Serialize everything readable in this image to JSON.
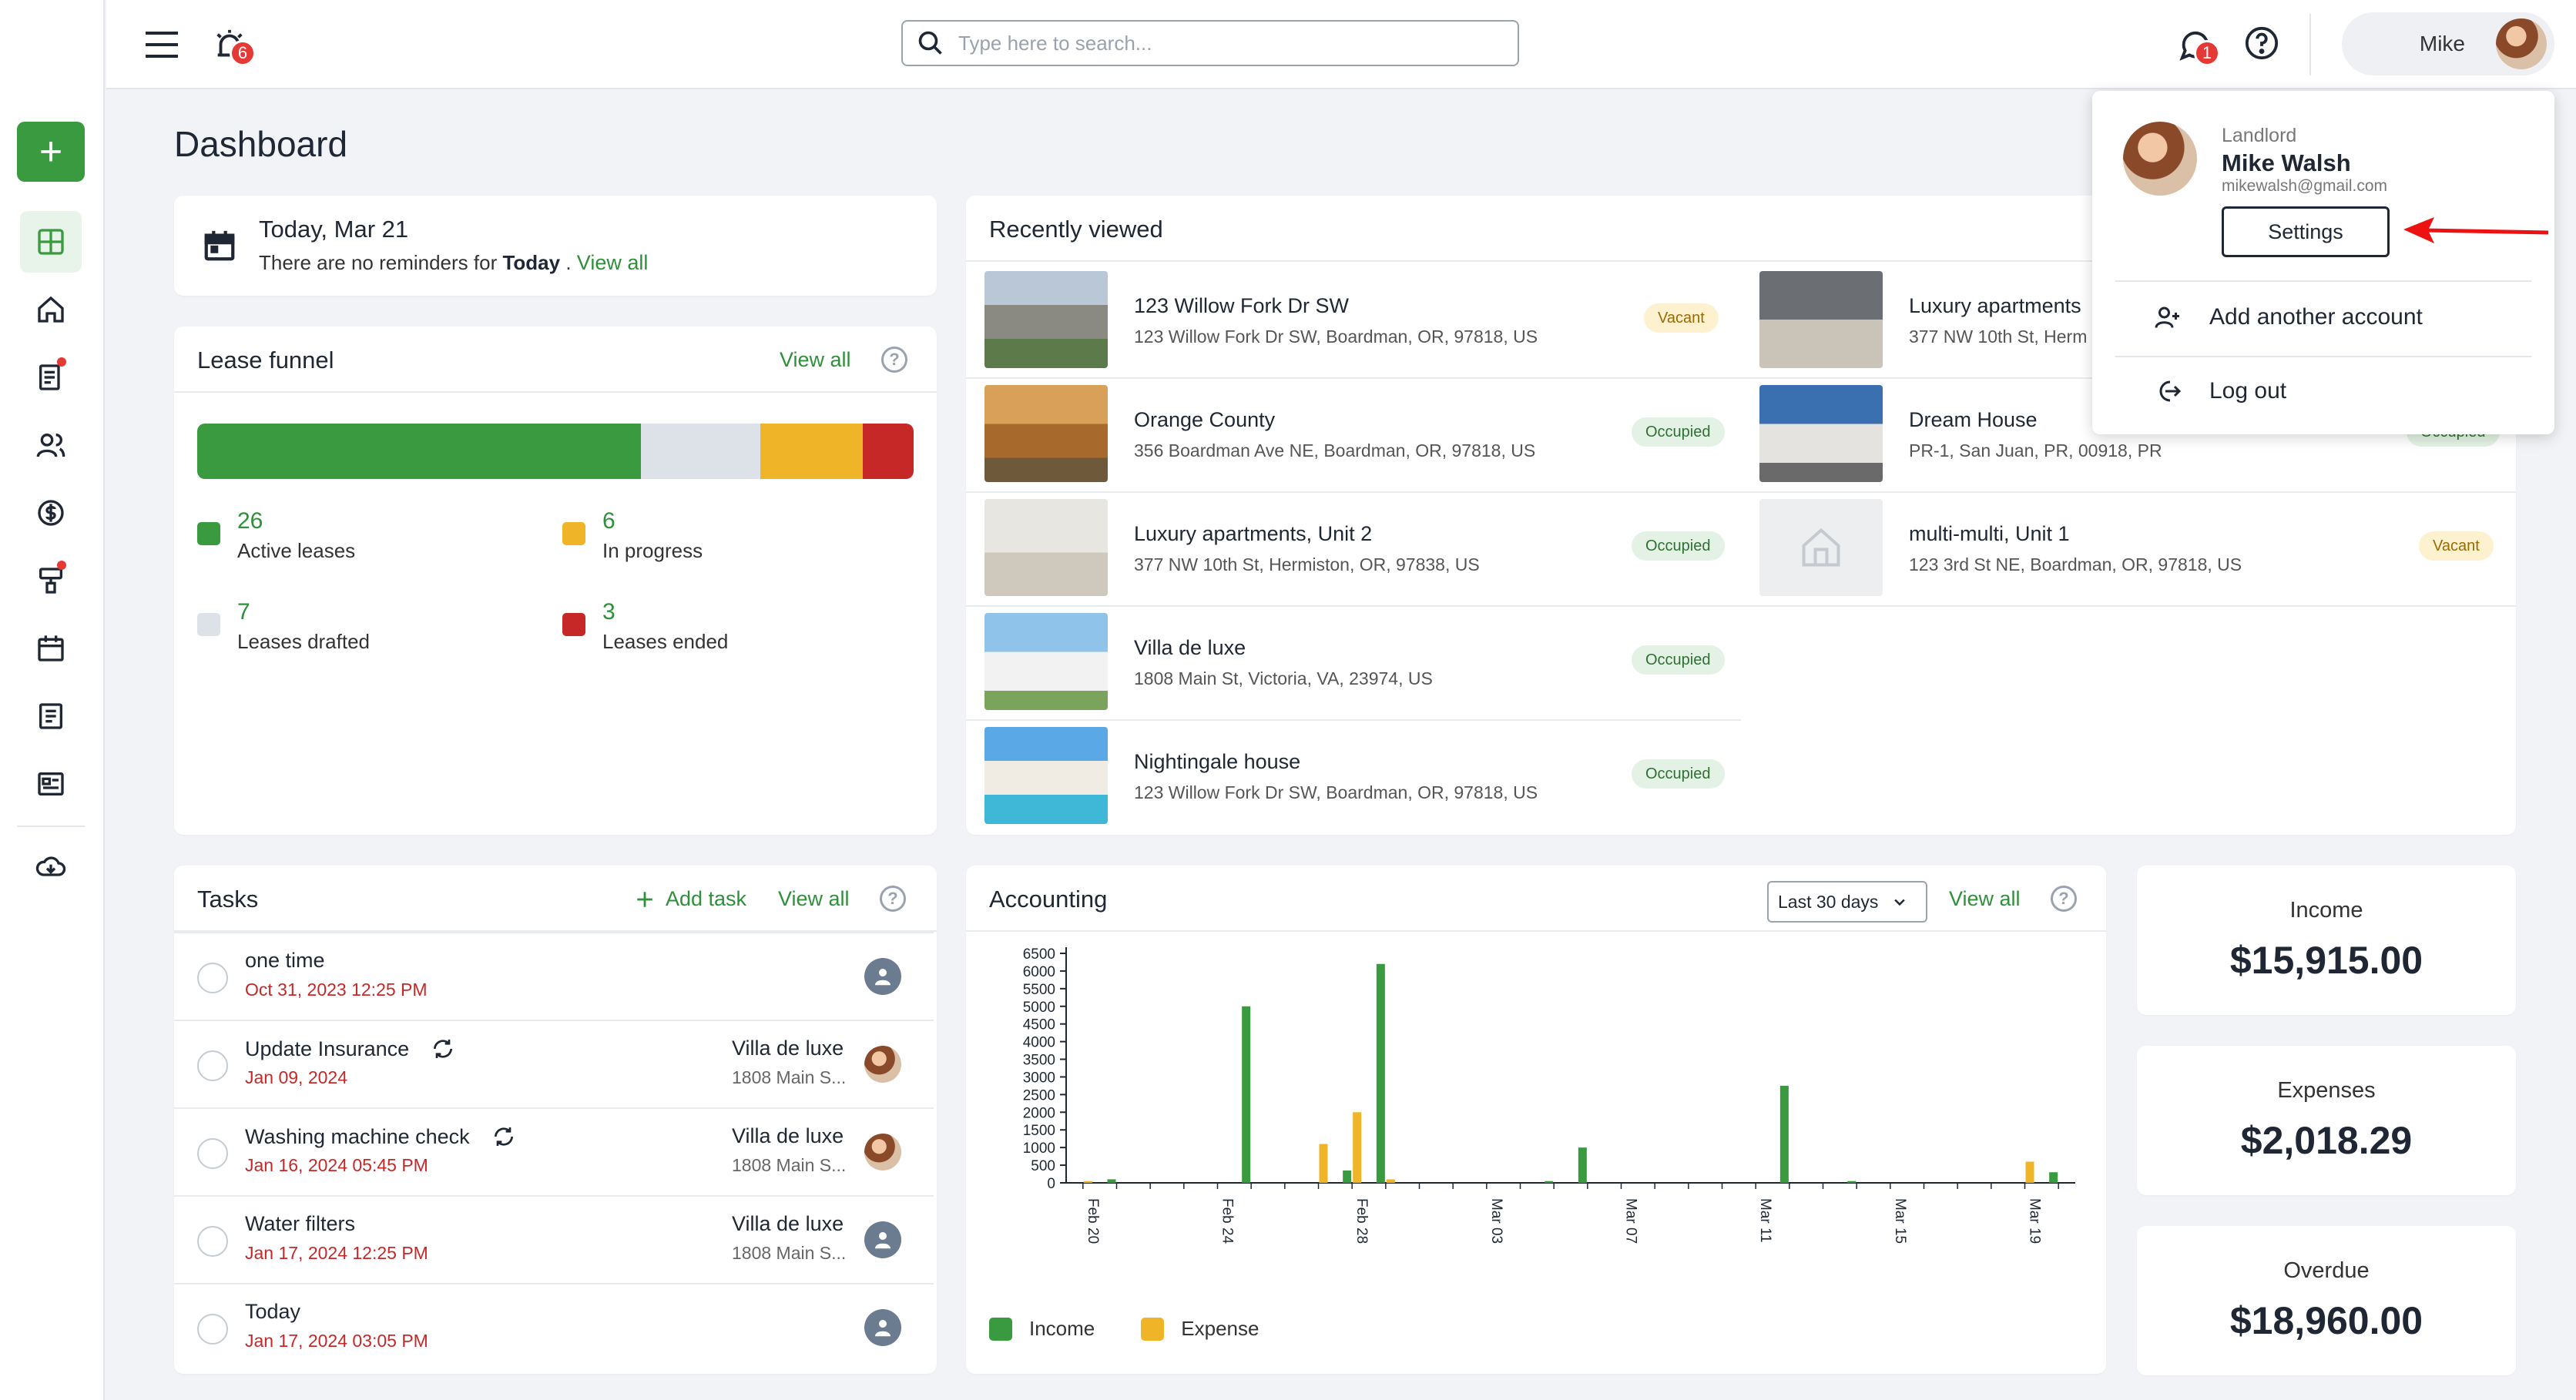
{
  "topbar": {
    "notifications_count": "6",
    "messages_count": "1",
    "search_placeholder": "Type here to search...",
    "user_name": "Mike"
  },
  "page_title": "Dashboard",
  "reminder": {
    "date": "Today, Mar 21",
    "text_prefix": "There are no reminders for ",
    "text_bold": "Today",
    "text_suffix": " .",
    "link": "View all"
  },
  "lease_funnel": {
    "title": "Lease funnel",
    "link": "View all",
    "segments": [
      {
        "label": "Active leases",
        "value": "26",
        "fraction": 0.619,
        "color": "#3a9a3f"
      },
      {
        "label": "Leases drafted",
        "value": "7",
        "fraction": 0.167,
        "color": "#dde2e8"
      },
      {
        "label": "In progress",
        "value": "6",
        "fraction": 0.143,
        "color": "#f0b429"
      },
      {
        "label": "Leases ended",
        "value": "3",
        "fraction": 0.071,
        "color": "#c62828"
      }
    ]
  },
  "recent": {
    "title": "Recently viewed",
    "items": [
      {
        "name": "123 Willow Fork Dr SW",
        "address": "123 Willow Fork Dr SW, Boardman, OR, 97818, US",
        "status": "Vacant"
      },
      {
        "name": "Orange County",
        "address": "356 Boardman Ave NE, Boardman, OR, 97818, US",
        "status": "Occupied"
      },
      {
        "name": "Luxury apartments, Unit 2",
        "address": "377 NW 10th St, Hermiston, OR, 97838, US",
        "status": "Occupied"
      },
      {
        "name": "Villa de luxe",
        "address": "1808 Main St, Victoria, VA, 23974, US",
        "status": "Occupied"
      },
      {
        "name": "Nightingale house",
        "address": "123 Willow Fork Dr SW, Boardman, OR, 97818, US",
        "status": "Occupied"
      },
      {
        "name": "Luxury apartments",
        "address": "377 NW 10th St, Herm",
        "status": ""
      },
      {
        "name": "Dream House",
        "address": "PR-1, San Juan, PR, 00918, PR",
        "status": "Occupied"
      },
      {
        "name": "multi-multi, Unit 1",
        "address": "123 3rd St NE, Boardman, OR, 97818, US",
        "status": "Vacant"
      }
    ]
  },
  "tasks": {
    "title": "Tasks",
    "add_label": "Add task",
    "link": "View all",
    "items": [
      {
        "name": "one time",
        "date": "Oct 31, 2023 12:25 PM",
        "property": "",
        "address": ""
      },
      {
        "name": "Update Insurance",
        "date": "Jan 09, 2024",
        "property": "Villa de luxe",
        "address": "1808 Main S..."
      },
      {
        "name": "Washing machine check",
        "date": "Jan 16, 2024 05:45 PM",
        "property": "Villa de luxe",
        "address": "1808 Main S..."
      },
      {
        "name": "Water filters",
        "date": "Jan 17, 2024 12:25 PM",
        "property": "Villa de luxe",
        "address": "1808 Main S..."
      },
      {
        "name": "Today",
        "date": "Jan 17, 2024 03:05 PM",
        "property": "",
        "address": ""
      }
    ]
  },
  "accounting": {
    "title": "Accounting",
    "range": "Last 30 days",
    "link": "View all",
    "legend_income": "Income",
    "legend_expense": "Expense"
  },
  "chart_data": {
    "type": "bar",
    "title": "",
    "categories": [
      "Feb 20",
      "Feb 21",
      "Feb 22",
      "Feb 23",
      "Feb 24",
      "Feb 25",
      "Feb 26",
      "Feb 27",
      "Feb 28",
      "Feb 29",
      "Mar 01",
      "Mar 02",
      "Mar 03",
      "Mar 04",
      "Mar 05",
      "Mar 06",
      "Mar 07",
      "Mar 08",
      "Mar 09",
      "Mar 10",
      "Mar 11",
      "Mar 12",
      "Mar 13",
      "Mar 14",
      "Mar 15",
      "Mar 16",
      "Mar 17",
      "Mar 18",
      "Mar 19",
      "Mar 20"
    ],
    "tick_labels": [
      "Feb 20",
      "Feb 24",
      "Feb 28",
      "Mar 03",
      "Mar 07",
      "Mar 11",
      "Mar 15",
      "Mar 19"
    ],
    "series": [
      {
        "name": "Income",
        "color": "#3a9a3f",
        "values": [
          0,
          100,
          0,
          0,
          0,
          5000,
          0,
          0,
          350,
          6200,
          0,
          0,
          0,
          0,
          50,
          1000,
          0,
          0,
          0,
          0,
          0,
          2750,
          0,
          50,
          0,
          0,
          0,
          0,
          0,
          300
        ]
      },
      {
        "name": "Expense",
        "color": "#f0b429",
        "values": [
          50,
          0,
          0,
          0,
          0,
          0,
          0,
          1100,
          2000,
          100,
          0,
          0,
          0,
          0,
          0,
          0,
          0,
          0,
          0,
          0,
          0,
          0,
          0,
          0,
          0,
          0,
          0,
          0,
          600,
          0
        ]
      }
    ],
    "ylim": [
      0,
      6500
    ],
    "yticks": [
      0,
      500,
      1000,
      1500,
      2000,
      2500,
      3000,
      3500,
      4000,
      4500,
      5000,
      5500,
      6000,
      6500
    ],
    "legend": "bottom-left"
  },
  "stats": {
    "income_label": "Income",
    "income_value": "$15,915.00",
    "expenses_label": "Expenses",
    "expenses_value": "$2,018.29",
    "overdue_label": "Overdue",
    "overdue_value": "$18,960.00"
  },
  "user_menu": {
    "role": "Landlord",
    "name": "Mike Walsh",
    "email": "mikewalsh@gmail.com",
    "settings": "Settings",
    "add_account": "Add another account",
    "logout": "Log out"
  }
}
